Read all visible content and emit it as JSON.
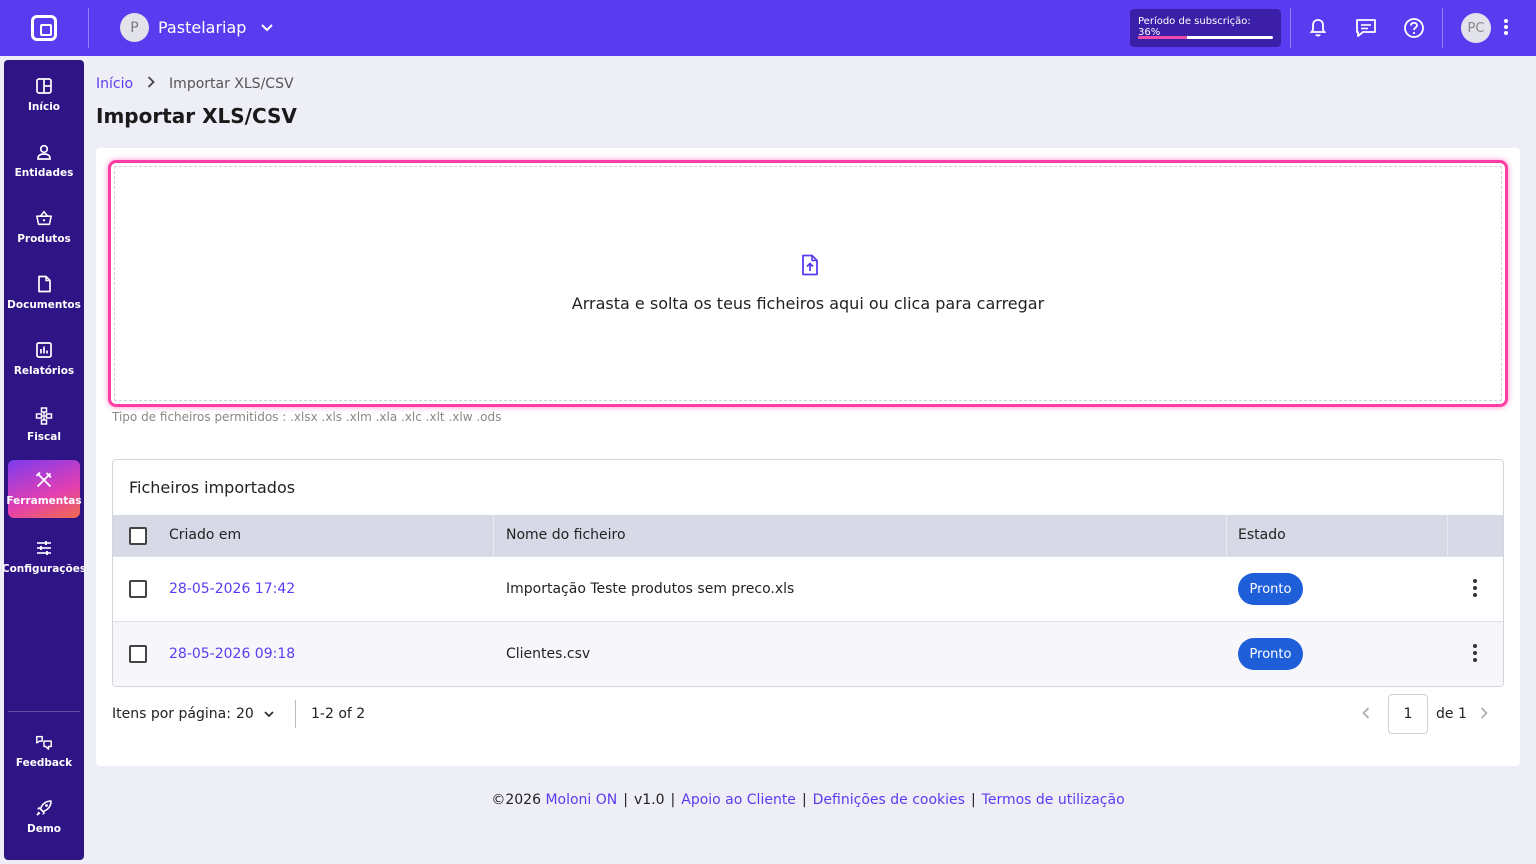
{
  "topbar": {
    "company_initial": "P",
    "company_name": "Pastelariap",
    "subscription_label": "Período de subscrição: 36%",
    "subscription_progress": 0.36,
    "user_initials": "PC",
    "icons": [
      "bell-icon",
      "chat-icon",
      "help-icon",
      "more-vertical-icon"
    ]
  },
  "sidebar": {
    "items": [
      {
        "label": "Início",
        "icon": "dashboard-icon"
      },
      {
        "label": "Entidades",
        "icon": "person-icon"
      },
      {
        "label": "Produtos",
        "icon": "basket-icon"
      },
      {
        "label": "Documentos",
        "icon": "document-icon"
      },
      {
        "label": "Relatórios",
        "icon": "chart-icon"
      },
      {
        "label": "Fiscal",
        "icon": "hierarchy-icon"
      },
      {
        "label": "Ferramentas",
        "icon": "tools-icon",
        "active": true
      },
      {
        "label": "Configurações",
        "icon": "sliders-icon"
      }
    ],
    "bottom_items": [
      {
        "label": "Feedback",
        "icon": "feedback-icon"
      },
      {
        "label": "Demo",
        "icon": "rocket-icon"
      }
    ]
  },
  "breadcrumb": {
    "home": "Início",
    "current": "Importar XLS/CSV"
  },
  "page_title": "Importar XLS/CSV",
  "dropzone": {
    "text": "Arrasta e solta os teus ficheiros aqui ou clica para carregar",
    "allowed_types": "Tipo de ficheiros permitidos : .xlsx .xls .xlm .xla .xlc .xlt .xlw .ods"
  },
  "imported": {
    "title": "Ficheiros importados",
    "columns": [
      "Criado em",
      "Nome do ficheiro",
      "Estado"
    ],
    "rows": [
      {
        "created": "28-05-2026 17:42",
        "filename": "Importação Teste produtos sem preco.xls",
        "status": "Pronto"
      },
      {
        "created": "28-05-2026 09:18",
        "filename": "Clientes.csv",
        "status": "Pronto"
      }
    ]
  },
  "pagination": {
    "per_page_label": "Itens por página:",
    "per_page_value": "20",
    "range": "1-2 of 2",
    "current_page": "1",
    "of_label": "de 1"
  },
  "footer": {
    "copyright": "©2026",
    "brand": "Moloni ON",
    "version": "v1.0",
    "support": "Apoio ao Cliente",
    "cookies": "Definições de cookies",
    "terms": "Termos de utilização"
  },
  "colors": {
    "primary": "#5a3cf0",
    "sidebar": "#2e1484",
    "accent_pink": "#ff3ea5",
    "status_badge": "#1e5fd9"
  }
}
